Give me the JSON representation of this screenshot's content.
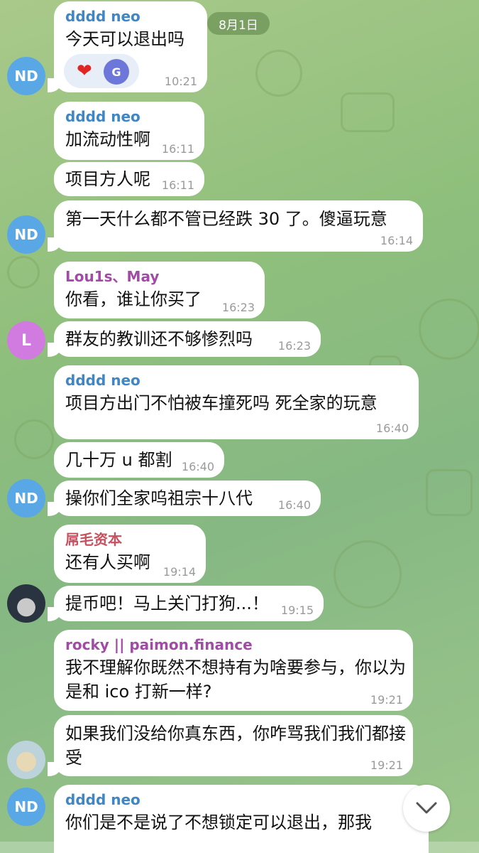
{
  "date_chip": "8月1日",
  "colors": {
    "name_blue": "#3e86c6",
    "name_purple": "#a14aa6",
    "name_red": "#c8505e",
    "avatar_blue": "#5aa7e6",
    "avatar_purple": "#d17ae0"
  },
  "messages": [
    {
      "sender": "dddd neo",
      "text": "今天可以退出吗",
      "time": "10:21"
    },
    {
      "sender": "dddd neo",
      "text": "加流动性啊",
      "time": "16:11"
    },
    {
      "text": "项目方人呢",
      "time": "16:11"
    },
    {
      "text": "第一天什么都不管已经跌 30 了。傻逼玩意",
      "time": "16:14"
    },
    {
      "sender": "Lou1s、May",
      "text": "你看，谁让你买了",
      "time": "16:23"
    },
    {
      "text": "群友的教训还不够惨烈吗",
      "time": "16:23"
    },
    {
      "sender": "dddd neo",
      "text": "项目方出门不怕被车撞死吗 死全家的玩意",
      "time": "16:40"
    },
    {
      "text": "几十万 u 都割",
      "time": "16:40"
    },
    {
      "text": "操你们全家呜祖宗十八代",
      "time": "16:40"
    },
    {
      "sender": "屌毛资本",
      "text": "还有人买啊",
      "time": "19:14"
    },
    {
      "text": "提币吧！马上关门打狗...！",
      "time": "19:15"
    },
    {
      "sender": "rocky || paimon.finance",
      "text": "我不理解你既然不想持有为啥要参与，你以为是和 ico 打新一样?",
      "time": "19:21"
    },
    {
      "text": "如果我们没给你真东西，你咋骂我们我们都接受",
      "time": "19:21"
    },
    {
      "sender": "dddd neo",
      "text": "你们是不是说了不想锁定可以退出，那我"
    }
  ],
  "reactions": {
    "heart": "❤",
    "badge": "G"
  },
  "avatars": {
    "nd": "ND",
    "l": "L"
  },
  "icons": {
    "scroll_down": "chevron-down-icon"
  }
}
